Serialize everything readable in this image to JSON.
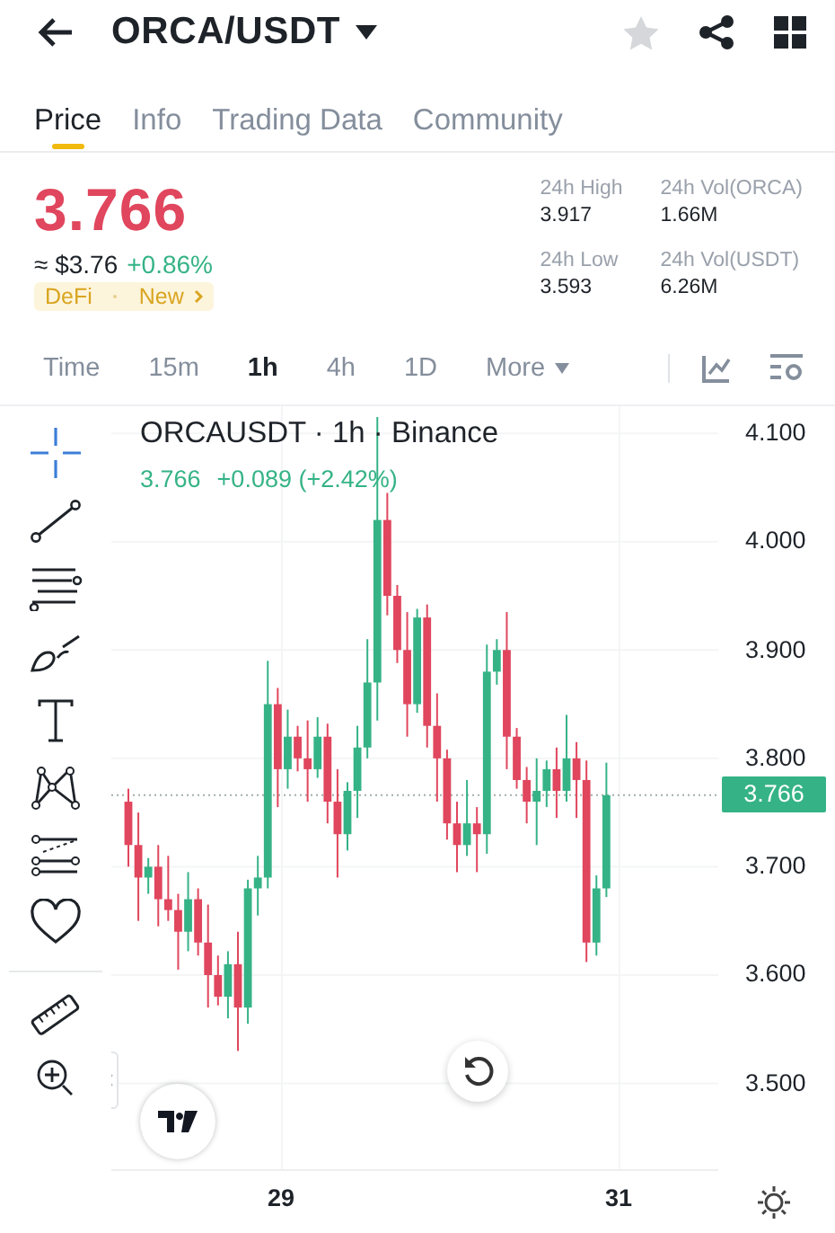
{
  "header": {
    "title": "ORCA/USDT"
  },
  "tabs": [
    {
      "label": "Price",
      "selected": true
    },
    {
      "label": "Info",
      "selected": false
    },
    {
      "label": "Trading Data",
      "selected": false
    },
    {
      "label": "Community",
      "selected": false
    }
  ],
  "price": {
    "last": "3.766",
    "fiat": "≈ $3.76",
    "change": "+0.86%",
    "tags": [
      "DeFi",
      "New"
    ]
  },
  "stats": [
    {
      "label": "24h High",
      "value": "3.917"
    },
    {
      "label": "24h Vol(ORCA)",
      "value": "1.66M"
    },
    {
      "label": "24h Low",
      "value": "3.593"
    },
    {
      "label": "24h Vol(USDT)",
      "value": "6.26M"
    }
  ],
  "intervals": [
    {
      "label": "Time",
      "kind": "plain",
      "selected": false
    },
    {
      "label": "15m",
      "kind": "plain",
      "selected": false
    },
    {
      "label": "1h",
      "kind": "plain",
      "selected": true
    },
    {
      "label": "4h",
      "kind": "plain",
      "selected": false
    },
    {
      "label": "1D",
      "kind": "plain",
      "selected": false
    },
    {
      "label": "More",
      "kind": "dropdown",
      "selected": false
    }
  ],
  "chart": {
    "legend": "ORCAUSDT · 1h · Binance",
    "quote": "3.766",
    "quote_change": "+0.089 (+2.42%)",
    "current_price": "3.766",
    "chart_data": {
      "type": "candlestick",
      "x": [
        28.09,
        28.149,
        28.208,
        28.267,
        28.326,
        28.385,
        28.444,
        28.503,
        28.562,
        28.621,
        28.68,
        28.739,
        28.798,
        28.857,
        28.916,
        28.975,
        29.034,
        29.093,
        29.152,
        29.211,
        29.27,
        29.329,
        29.388,
        29.447,
        29.506,
        29.565,
        29.624,
        29.683,
        29.742,
        29.801,
        29.86,
        29.919,
        29.978,
        30.037,
        30.096,
        30.155,
        30.214,
        30.273,
        30.332,
        30.391,
        30.45,
        30.509,
        30.568,
        30.627,
        30.686,
        30.745,
        30.804,
        30.863,
        30.922
      ],
      "ohlc": [
        [
          3.76,
          3.772,
          3.7,
          3.72
        ],
        [
          3.72,
          3.75,
          3.65,
          3.69
        ],
        [
          3.69,
          3.708,
          3.675,
          3.7
        ],
        [
          3.7,
          3.72,
          3.645,
          3.67
        ],
        [
          3.67,
          3.71,
          3.65,
          3.66
        ],
        [
          3.66,
          3.675,
          3.605,
          3.64
        ],
        [
          3.64,
          3.695,
          3.622,
          3.67
        ],
        [
          3.67,
          3.68,
          3.618,
          3.63
        ],
        [
          3.63,
          3.665,
          3.57,
          3.6
        ],
        [
          3.6,
          3.618,
          3.572,
          3.58
        ],
        [
          3.58,
          3.622,
          3.56,
          3.61
        ],
        [
          3.61,
          3.64,
          3.53,
          3.57
        ],
        [
          3.57,
          3.688,
          3.555,
          3.68
        ],
        [
          3.68,
          3.71,
          3.655,
          3.69
        ],
        [
          3.69,
          3.89,
          3.68,
          3.85
        ],
        [
          3.85,
          3.865,
          3.755,
          3.79
        ],
        [
          3.79,
          3.845,
          3.772,
          3.82
        ],
        [
          3.82,
          3.83,
          3.788,
          3.8
        ],
        [
          3.8,
          3.835,
          3.76,
          3.79
        ],
        [
          3.79,
          3.838,
          3.782,
          3.82
        ],
        [
          3.82,
          3.832,
          3.74,
          3.76
        ],
        [
          3.76,
          3.79,
          3.69,
          3.73
        ],
        [
          3.73,
          3.778,
          3.715,
          3.77
        ],
        [
          3.77,
          3.83,
          3.745,
          3.81
        ],
        [
          3.81,
          3.91,
          3.8,
          3.87
        ],
        [
          3.87,
          4.115,
          3.835,
          4.02
        ],
        [
          4.02,
          4.045,
          3.932,
          3.95
        ],
        [
          3.95,
          3.96,
          3.888,
          3.9
        ],
        [
          3.9,
          3.935,
          3.82,
          3.85
        ],
        [
          3.85,
          3.938,
          3.842,
          3.93
        ],
        [
          3.93,
          3.942,
          3.81,
          3.83
        ],
        [
          3.83,
          3.86,
          3.76,
          3.8
        ],
        [
          3.8,
          3.808,
          3.725,
          3.74
        ],
        [
          3.74,
          3.76,
          3.695,
          3.72
        ],
        [
          3.72,
          3.78,
          3.71,
          3.74
        ],
        [
          3.74,
          3.755,
          3.695,
          3.73
        ],
        [
          3.73,
          3.905,
          3.712,
          3.88
        ],
        [
          3.88,
          3.91,
          3.868,
          3.9
        ],
        [
          3.9,
          3.935,
          3.79,
          3.82
        ],
        [
          3.82,
          3.828,
          3.772,
          3.78
        ],
        [
          3.78,
          3.792,
          3.74,
          3.76
        ],
        [
          3.76,
          3.8,
          3.72,
          3.77
        ],
        [
          3.77,
          3.798,
          3.755,
          3.79
        ],
        [
          3.79,
          3.81,
          3.745,
          3.77
        ],
        [
          3.77,
          3.84,
          3.76,
          3.8
        ],
        [
          3.8,
          3.815,
          3.745,
          3.78
        ],
        [
          3.78,
          3.798,
          3.612,
          3.63
        ],
        [
          3.63,
          3.692,
          3.618,
          3.68
        ],
        [
          3.68,
          3.796,
          3.672,
          3.766
        ]
      ],
      "xlim": [
        27.989,
        31.585
      ],
      "ylim": [
        3.42,
        4.125
      ],
      "grid": true,
      "ref_lines": [
        {
          "axis": "y",
          "value": 3.766
        }
      ],
      "xticks": [
        29,
        31
      ],
      "yticks": [
        {
          "value": 4.1,
          "label": "4.100"
        },
        {
          "value": 4.0,
          "label": "4.000"
        },
        {
          "value": 3.9,
          "label": "3.900"
        },
        {
          "value": 3.8,
          "label": "3.800"
        },
        {
          "value": 3.7,
          "label": "3.700"
        },
        {
          "value": 3.6,
          "label": "3.600"
        },
        {
          "value": 3.5,
          "label": "3.500"
        }
      ]
    }
  }
}
